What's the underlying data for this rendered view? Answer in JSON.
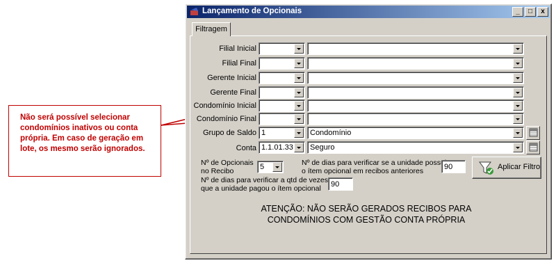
{
  "callout": {
    "text": "Não será possível selecionar condomínios inativos ou conta própria. Em caso de geração em lote, os mesmo serão ignorados."
  },
  "window": {
    "title": "Lançamento de Opcionais",
    "minimize": "_",
    "maximize": "□",
    "close": "x",
    "tab": "Filtragem"
  },
  "form": {
    "filial_inicial": {
      "label": "Filial Inicial",
      "code": "",
      "name": ""
    },
    "filial_final": {
      "label": "Filial Final",
      "code": "",
      "name": ""
    },
    "gerente_inicial": {
      "label": "Gerente Inicial",
      "code": "",
      "name": ""
    },
    "gerente_final": {
      "label": "Gerente Final",
      "code": "",
      "name": ""
    },
    "condominio_inicial": {
      "label": "Condomínio Inicial",
      "code": "",
      "name": ""
    },
    "condominio_final": {
      "label": "Condomínio Final",
      "code": "",
      "name": ""
    },
    "grupo_saldo": {
      "label": "Grupo de Saldo",
      "code": "1",
      "name": "Condomínio"
    },
    "conta": {
      "label": "Conta",
      "code": "1.1.01.33",
      "name": "Seguro"
    },
    "opcionais": {
      "label_line1": "Nº de Opcionais",
      "label_line2": "no Recibo",
      "value": "5"
    },
    "dias_verificar": {
      "label_line1": "Nº de dias para verificar se a unidade possui",
      "label_line2": "o ítem opcional em recibos anteriores",
      "value": "90"
    },
    "dias_qtd": {
      "label_line1": "Nº de dias para verificar a qtd de vezes",
      "label_line2": "que a unidade pagou o ítem opcional",
      "value": "90"
    },
    "apply_button": "Aplicar Filtro"
  },
  "warning": {
    "line1": "ATENÇÃO: NÃO SERÃO GERADOS RECIBOS PARA",
    "line2": "CONDOMÍNIOS COM GESTÃO CONTA PRÓPRIA"
  }
}
